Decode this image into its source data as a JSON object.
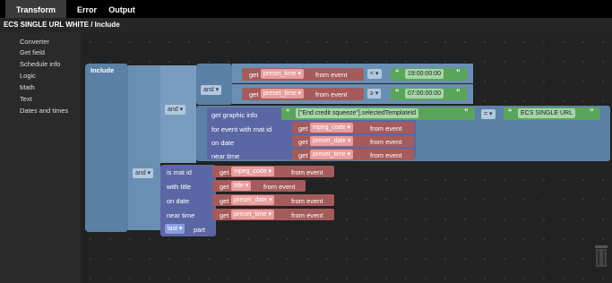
{
  "tabs": [
    "Transform",
    "Error",
    "Output"
  ],
  "breadcrumb": "ECS SINGLE URL WHITE / Include",
  "sidebar": [
    "Converter",
    "Get field",
    "Schedule info",
    "Logic",
    "Math",
    "Text",
    "Dates and times"
  ],
  "blocks": {
    "include": "Include",
    "and": "and",
    "get": "get",
    "from_event": "from event",
    "preset_time": "preset_time",
    "preset_date": "preset_date",
    "mpeg_code": "mpeg_code",
    "title": "title",
    "lt": "<",
    "ge": "≥",
    "eq": "=",
    "time1": "19:00:00:00",
    "time2": "07:00:00:00",
    "get_graphic_info": "get graphic info",
    "for_event": "for event with mat id",
    "on_date": "on date",
    "near_time": "near time",
    "template_expr": "[\"End credit squeeze\"].selectedTemplateId",
    "ecs": "ECS SINGLE URL",
    "is_mat_id": "is mat id",
    "with_title": "with title",
    "last": "last",
    "part": "part",
    "open_q": "“",
    "close_q": "”",
    "arrow": "▾"
  }
}
